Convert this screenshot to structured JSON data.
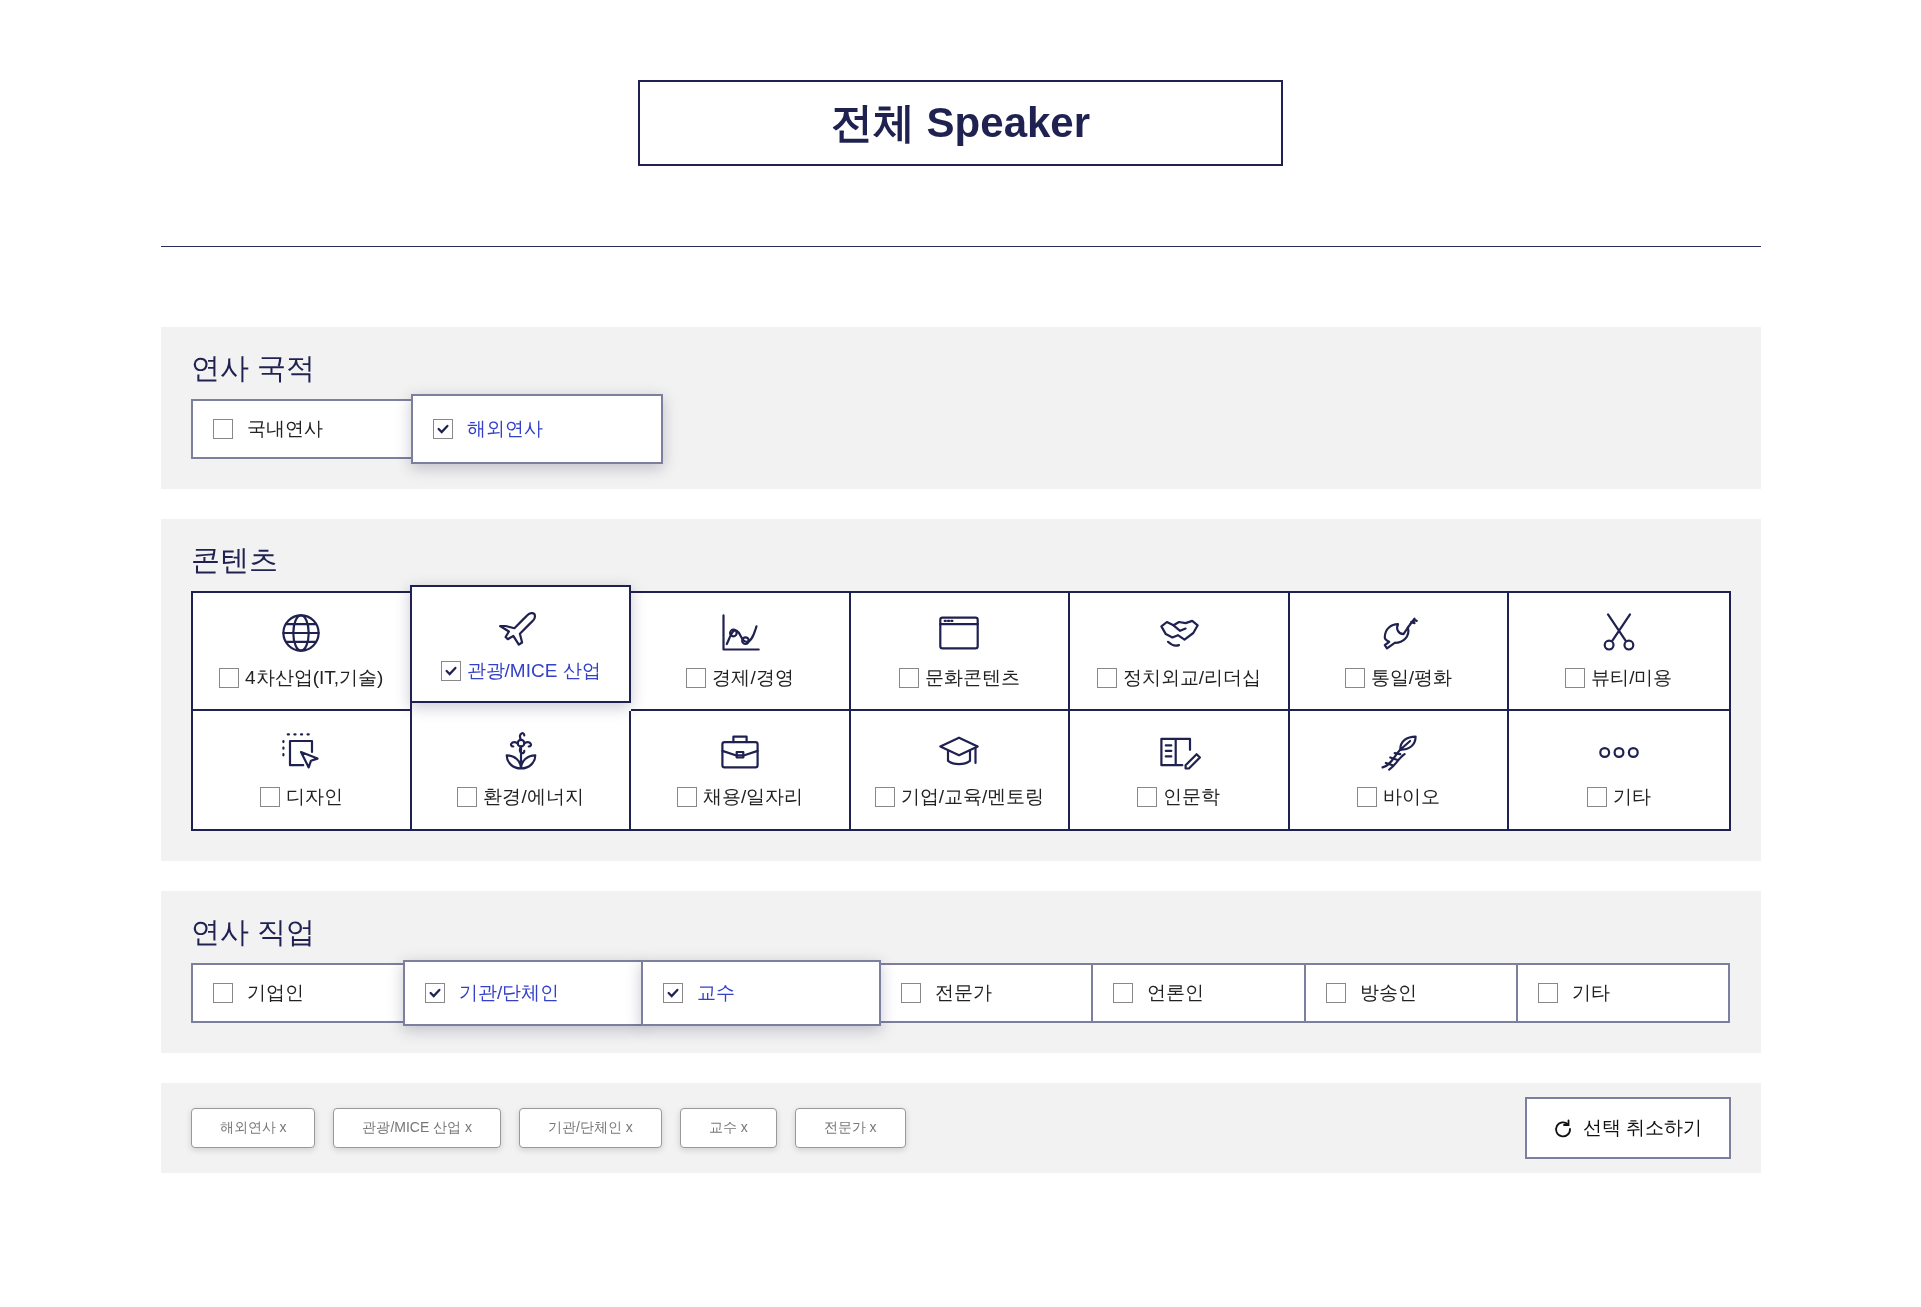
{
  "title": "전체 Speaker",
  "nationality": {
    "heading": "연사 국적",
    "options": [
      {
        "label": "국내연사",
        "checked": false
      },
      {
        "label": "해외연사",
        "checked": true
      }
    ]
  },
  "contents": {
    "heading": "콘텐츠",
    "items": [
      {
        "label": "4차산업(IT,기술)",
        "checked": false
      },
      {
        "label": "관광/MICE 산업",
        "checked": true
      },
      {
        "label": "경제/경영",
        "checked": false
      },
      {
        "label": "문화콘텐츠",
        "checked": false
      },
      {
        "label": "정치외교/리더십",
        "checked": false
      },
      {
        "label": "통일/평화",
        "checked": false
      },
      {
        "label": "뷰티/미용",
        "checked": false
      },
      {
        "label": "디자인",
        "checked": false
      },
      {
        "label": "환경/에너지",
        "checked": false
      },
      {
        "label": "채용/일자리",
        "checked": false
      },
      {
        "label": "기업/교육/멘토링",
        "checked": false
      },
      {
        "label": "인문학",
        "checked": false
      },
      {
        "label": "바이오",
        "checked": false
      },
      {
        "label": "기타",
        "checked": false
      }
    ]
  },
  "occupation": {
    "heading": "연사 직업",
    "options": [
      {
        "label": "기업인",
        "checked": false
      },
      {
        "label": "기관/단체인",
        "checked": true
      },
      {
        "label": "교수",
        "checked": true
      },
      {
        "label": "전문가",
        "checked": false
      },
      {
        "label": "언론인",
        "checked": false
      },
      {
        "label": "방송인",
        "checked": false
      },
      {
        "label": "기타",
        "checked": false
      }
    ]
  },
  "selected_filters": [
    "해외연사 x",
    "관광/MICE 산업 x",
    "기관/단체인 x",
    "교수 x",
    "전문가 x"
  ],
  "reset_button": "선택 취소하기"
}
